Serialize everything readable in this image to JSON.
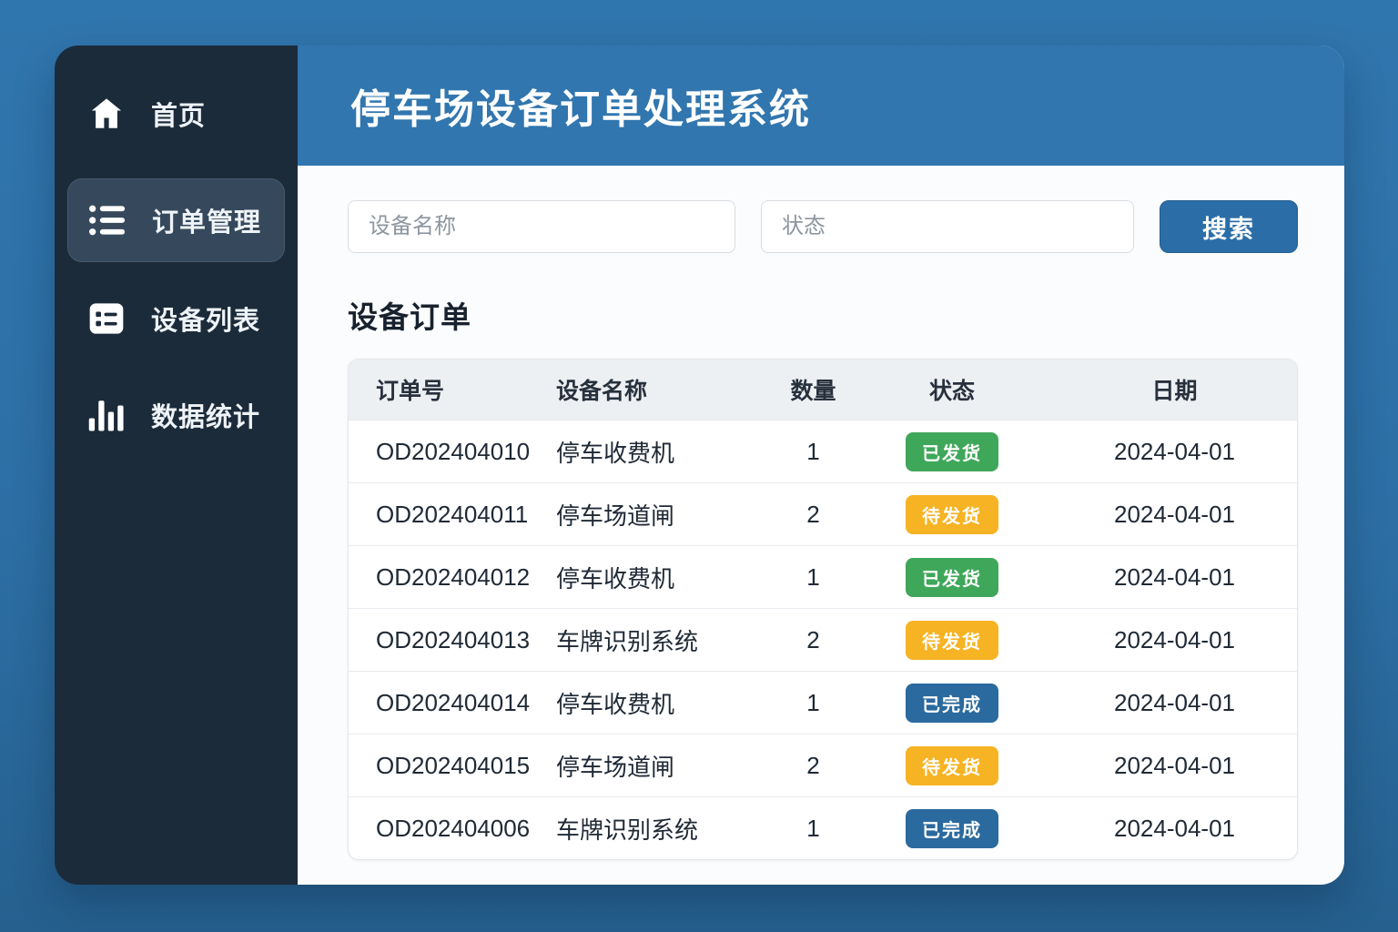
{
  "app": {
    "title": "停车场设备订单处理系统"
  },
  "colors": {
    "background_blue": "#2d6fa5",
    "header_blue": "#3176ae",
    "sidebar_dark": "#1c2b3a",
    "sidebar_active_bg": "#36495c",
    "search_button_blue": "#2b6ea7",
    "status_shipped_green": "#3fa75a",
    "status_pending_yellow": "#f6b324",
    "status_completed_blue": "#2a6a9e"
  },
  "sidebar": {
    "items": [
      {
        "label": "首页",
        "icon": "home-icon",
        "active": false
      },
      {
        "label": "订单管理",
        "icon": "order-list-icon",
        "active": true
      },
      {
        "label": "设备列表",
        "icon": "device-list-icon",
        "active": false
      },
      {
        "label": "数据统计",
        "icon": "bar-chart-icon",
        "active": false
      }
    ]
  },
  "search": {
    "device_placeholder": "设备名称",
    "status_placeholder": "状态",
    "button_label": "搜索"
  },
  "section": {
    "title": "设备订单"
  },
  "table": {
    "headers": [
      "订单号",
      "设备名称",
      "数量",
      "状态",
      "日期"
    ],
    "rows": [
      {
        "order_no": "OD202404010",
        "device": "停车收费机",
        "qty": "1",
        "status": "已发货",
        "status_type": "shipped",
        "date": "2024-04-01"
      },
      {
        "order_no": "OD202404011",
        "device": "停车场道闸",
        "qty": "2",
        "status": "待发货",
        "status_type": "pending",
        "date": "2024-04-01"
      },
      {
        "order_no": "OD202404012",
        "device": "停车收费机",
        "qty": "1",
        "status": "已发货",
        "status_type": "shipped",
        "date": "2024-04-01"
      },
      {
        "order_no": "OD202404013",
        "device": "车牌识别系统",
        "qty": "2",
        "status": "待发货",
        "status_type": "pending",
        "date": "2024-04-01"
      },
      {
        "order_no": "OD202404014",
        "device": "停车收费机",
        "qty": "1",
        "status": "已完成",
        "status_type": "completed",
        "date": "2024-04-01"
      },
      {
        "order_no": "OD202404015",
        "device": "停车场道闸",
        "qty": "2",
        "status": "待发货",
        "status_type": "pending",
        "date": "2024-04-01"
      },
      {
        "order_no": "OD202404006",
        "device": "车牌识别系统",
        "qty": "1",
        "status": "已完成",
        "status_type": "completed",
        "date": "2024-04-01"
      }
    ]
  }
}
